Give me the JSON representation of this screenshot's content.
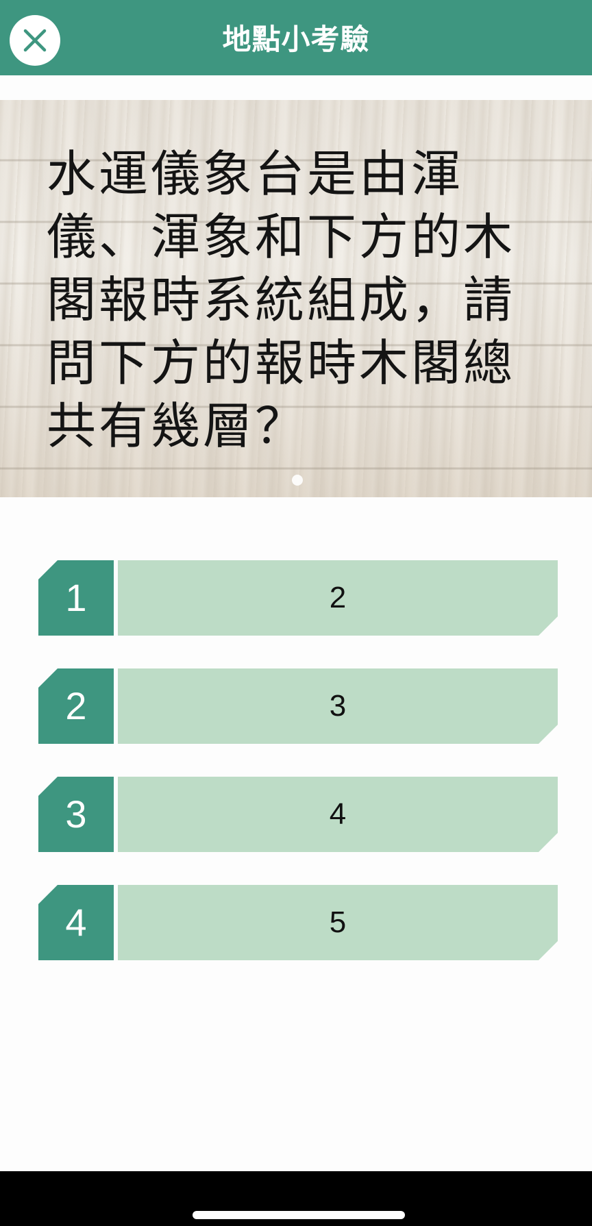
{
  "header": {
    "title": "地點小考驗",
    "close_icon": "close-icon"
  },
  "question": {
    "text": "水運儀象台是由渾儀、渾象和下方的木閣報時系統組成，請問下方的報時木閣總共有幾層？"
  },
  "options": [
    {
      "number": "1",
      "answer": "2"
    },
    {
      "number": "2",
      "answer": "3"
    },
    {
      "number": "3",
      "answer": "4"
    },
    {
      "number": "4",
      "answer": "5"
    }
  ],
  "colors": {
    "accent": "#3e9680",
    "option_fill": "#bddcc6",
    "background": "#fdfdfd"
  }
}
